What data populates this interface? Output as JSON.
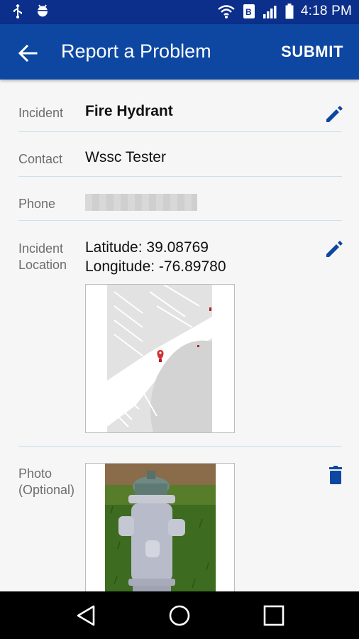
{
  "status_bar": {
    "time": "4:18 PM",
    "icons": [
      "usb-icon",
      "android-debug-icon",
      "wifi-icon",
      "signal-icon",
      "battery-icon"
    ]
  },
  "app_bar": {
    "title": "Report a Problem",
    "submit_label": "SUBMIT",
    "back_icon": "arrow-back-icon",
    "color": "#0d47a1"
  },
  "form": {
    "incident": {
      "label": "Incident",
      "value": "Fire Hydrant"
    },
    "contact": {
      "label": "Contact",
      "value": "Wssc Tester"
    },
    "phone": {
      "label": "Phone"
    },
    "location": {
      "label_line1": "Incident",
      "label_line2": "Location",
      "latitude": "Latitude: 39.08769",
      "longitude": "Longitude: -76.89780"
    },
    "photo": {
      "label_line1": "Photo",
      "label_line2": "(Optional)"
    }
  },
  "nav_bar": {
    "buttons": [
      "back-triangle-icon",
      "home-circle-icon",
      "recents-square-icon"
    ]
  }
}
